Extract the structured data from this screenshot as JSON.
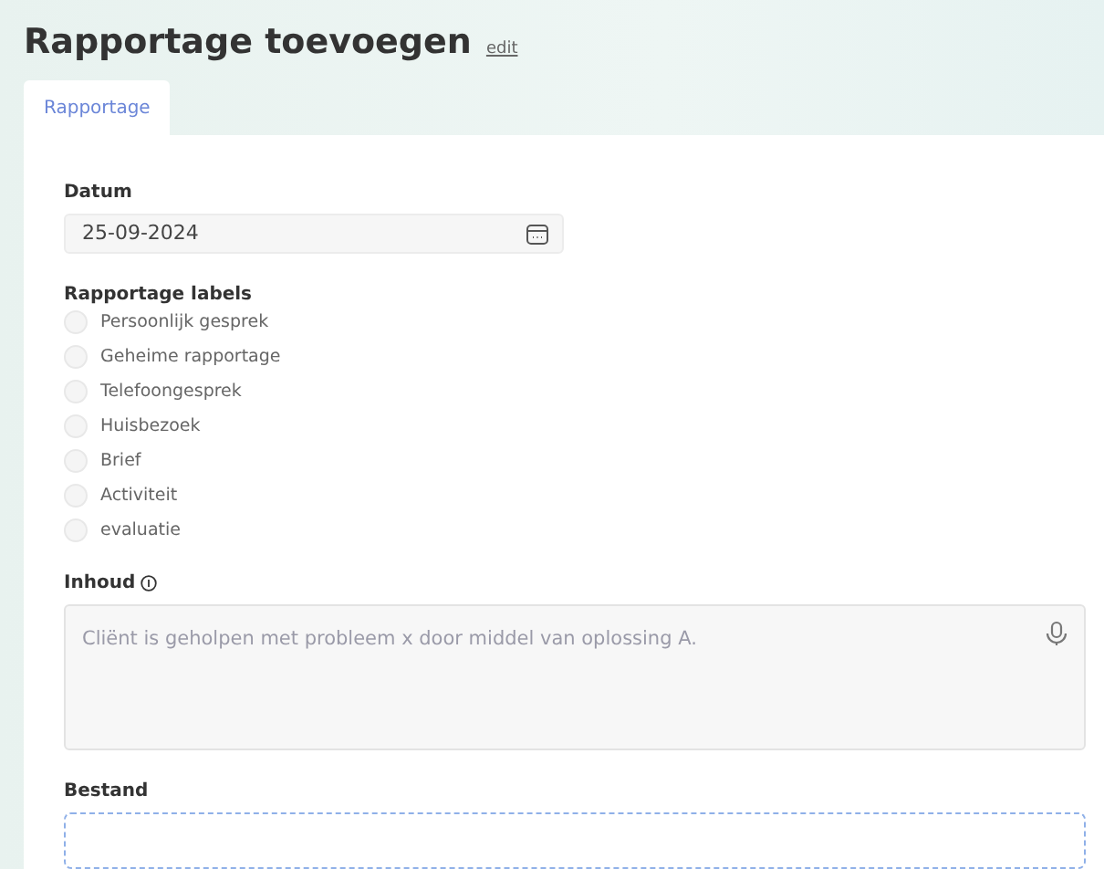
{
  "header": {
    "title": "Rapportage toevoegen",
    "edit_link": "edit"
  },
  "tabs": [
    {
      "label": "Rapportage",
      "selected": true
    }
  ],
  "form": {
    "date": {
      "label": "Datum",
      "value": "25-09-2024"
    },
    "labels": {
      "label": "Rapportage labels",
      "options": [
        {
          "label": "Persoonlijk gesprek",
          "checked": false
        },
        {
          "label": "Geheime rapportage",
          "checked": false
        },
        {
          "label": "Telefoongesprek",
          "checked": false
        },
        {
          "label": "Huisbezoek",
          "checked": false
        },
        {
          "label": "Brief",
          "checked": false
        },
        {
          "label": "Activiteit",
          "checked": false
        },
        {
          "label": "evaluatie",
          "checked": false
        }
      ]
    },
    "content": {
      "label": "Inhoud",
      "placeholder": "Cliënt is geholpen met probleem x door middel van oplossing A."
    },
    "file": {
      "label": "Bestand"
    }
  }
}
